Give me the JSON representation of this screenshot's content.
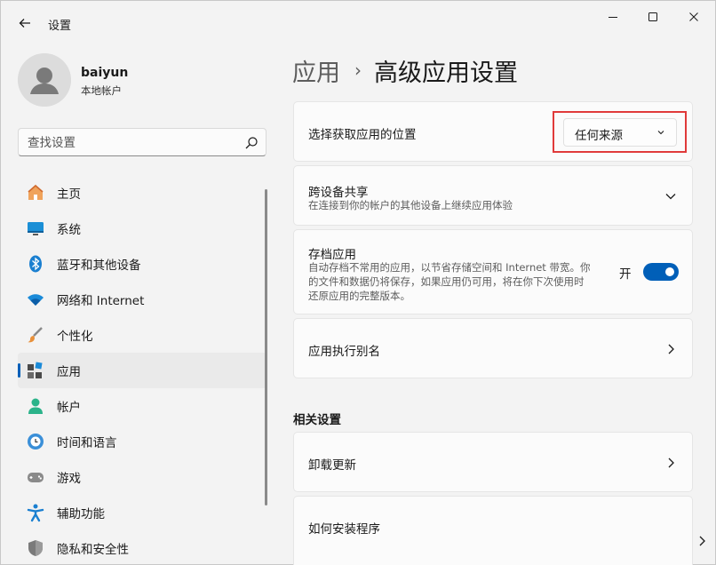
{
  "window": {
    "title": "设置",
    "back_icon": "back-arrow-icon",
    "controls": [
      "minimize-icon",
      "maximize-icon",
      "close-icon"
    ]
  },
  "user": {
    "name": "baiyun",
    "account_type": "本地帐户"
  },
  "search": {
    "placeholder": "查找设置",
    "icon": "search-icon"
  },
  "sidebar": {
    "items": [
      {
        "label": "主页",
        "icon": "home-icon"
      },
      {
        "label": "系统",
        "icon": "display-icon"
      },
      {
        "label": "蓝牙和其他设备",
        "icon": "bluetooth-icon"
      },
      {
        "label": "网络和 Internet",
        "icon": "wifi-icon"
      },
      {
        "label": "个性化",
        "icon": "brush-icon"
      },
      {
        "label": "应用",
        "icon": "apps-icon",
        "active": true
      },
      {
        "label": "帐户",
        "icon": "person-icon"
      },
      {
        "label": "时间和语言",
        "icon": "globe-clock-icon"
      },
      {
        "label": "游戏",
        "icon": "gamepad-icon"
      },
      {
        "label": "辅助功能",
        "icon": "accessibility-icon"
      },
      {
        "label": "隐私和安全性",
        "icon": "shield-icon"
      }
    ]
  },
  "breadcrumb": {
    "parent": "应用",
    "separator": "›",
    "current": "高级应用设置"
  },
  "settings": {
    "install_source": {
      "title": "选择获取应用的位置",
      "dropdown_value": "任何来源"
    },
    "share_across_devices": {
      "title": "跨设备共享",
      "description": "在连接到你的帐户的其他设备上继续应用体验"
    },
    "archive_apps": {
      "title": "存档应用",
      "description_lines": [
        "自动存档不常用的应用，以节省存储空间和 Internet 带宽。你",
        "的文件和数据仍将保存，如果应用仍可用，将在你下次使用时",
        "还原应用的完整版本。"
      ],
      "toggle_label": "开",
      "toggle_on": true
    },
    "app_execution_aliases": {
      "title": "应用执行别名"
    }
  },
  "related": {
    "heading": "相关设置",
    "items": [
      {
        "title": "卸载更新"
      },
      {
        "title": "如何安装程序"
      }
    ]
  },
  "colors": {
    "accent": "#005fb8",
    "highlight": "#e03a3a"
  }
}
